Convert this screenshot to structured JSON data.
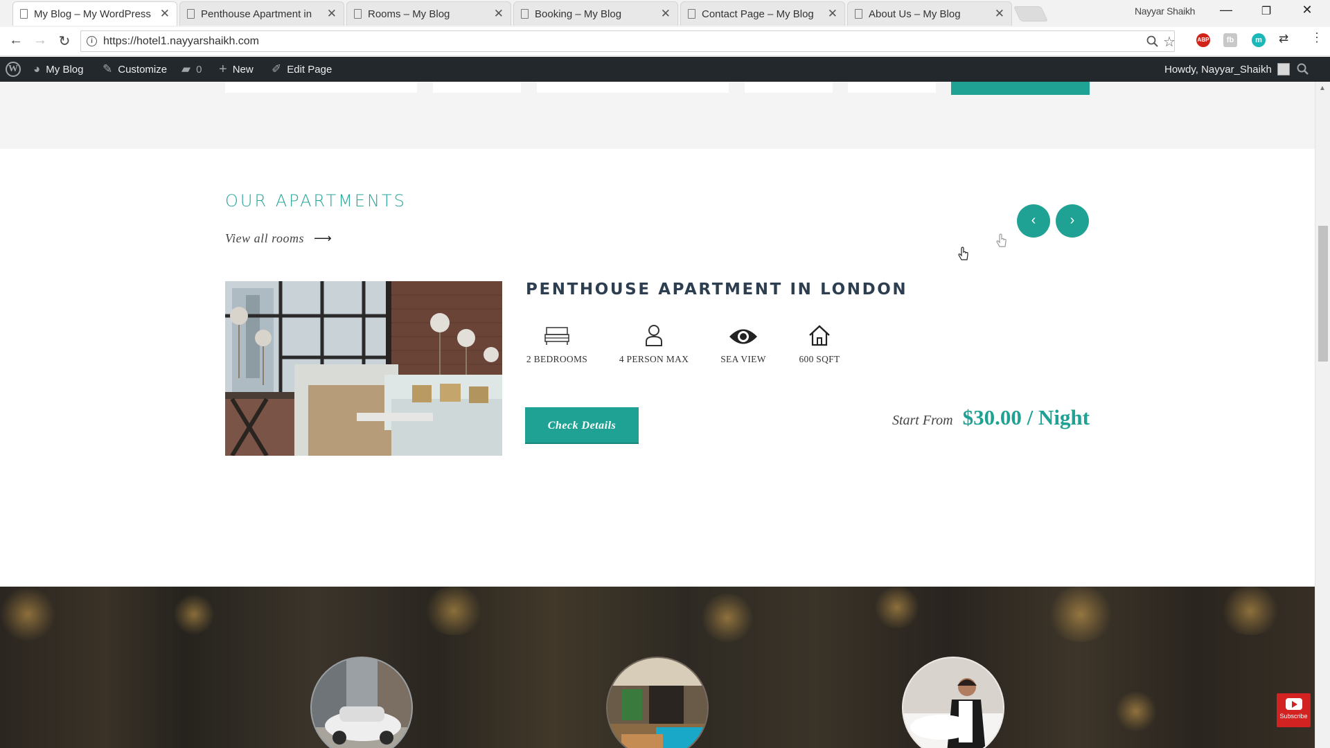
{
  "browser": {
    "tabs": [
      {
        "title": "My Blog – My WordPress",
        "active": true
      },
      {
        "title": "Penthouse Apartment in",
        "active": false
      },
      {
        "title": "Rooms – My Blog",
        "active": false
      },
      {
        "title": "Booking – My Blog",
        "active": false
      },
      {
        "title": "Contact Page – My Blog",
        "active": false
      },
      {
        "title": "About Us – My Blog",
        "active": false
      }
    ],
    "profile_name": "Nayyar Shaikh",
    "url": "https://hotel1.nayyarshaikh.com",
    "extensions": [
      "ABP",
      "fb",
      "m"
    ]
  },
  "adminbar": {
    "site_name": "My Blog",
    "customize": "Customize",
    "comments_count": "0",
    "new_label": "New",
    "edit_label": "Edit Page",
    "howdy": "Howdy, Nayyar_Shaikh"
  },
  "section": {
    "title": "OUR APARTMENTS",
    "view_all": "View all rooms"
  },
  "room": {
    "title": "PENTHOUSE APARTMENT IN LONDON",
    "amenities": [
      {
        "icon": "bed-icon",
        "label": "2 BEDROOMS"
      },
      {
        "icon": "person-icon",
        "label": "4 PERSON MAX"
      },
      {
        "icon": "eye-icon",
        "label": "SEA VIEW"
      },
      {
        "icon": "house-icon",
        "label": "600 SQFT"
      }
    ],
    "button": "Check Details",
    "price_prefix": "Start From",
    "price": "$30.00 / Night"
  },
  "overlay": {
    "subscribe": "Subscribe"
  },
  "colors": {
    "accent": "#1fa293",
    "title_color": "#26a69a",
    "adminbar": "#23282d"
  }
}
